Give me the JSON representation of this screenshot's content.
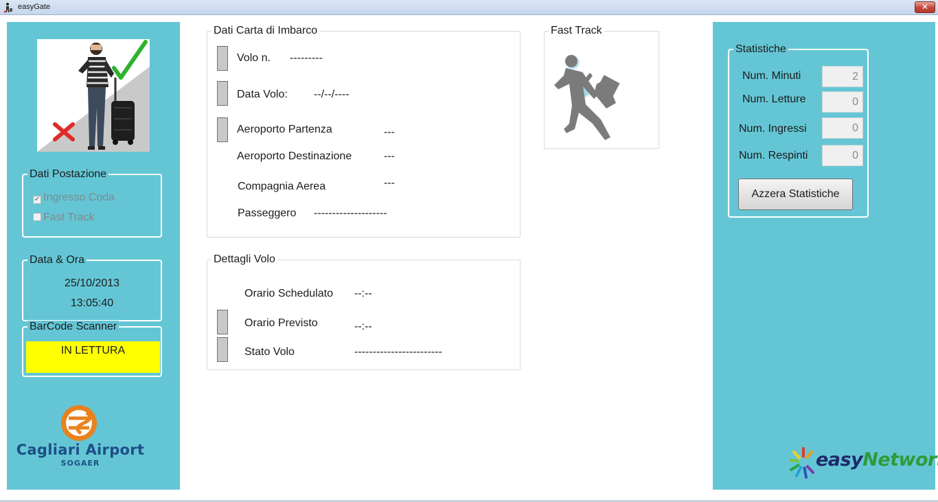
{
  "window": {
    "title": "easyGate",
    "close_glyph": "✕"
  },
  "left": {
    "postazione": {
      "legend": "Dati Postazione",
      "ingresso_coda": "Ingresso Coda",
      "ingresso_coda_checked": true,
      "fast_track": "Fast Track",
      "fast_track_checked": false
    },
    "datetime": {
      "legend": "Data & Ora",
      "date": "25/10/2013",
      "time": "13:05:40"
    },
    "scanner": {
      "legend": "BarCode Scanner",
      "status": "IN LETTURA"
    },
    "logo": {
      "name": "Cagliari Airport",
      "sub": "SOGAER"
    }
  },
  "boarding": {
    "legend": "Dati Carta di Imbarco",
    "volo_label": "Volo n.",
    "volo_value": "---------",
    "data_label": "Data Volo:",
    "data_value": "--/--/----",
    "partenza_label": "Aeroporto Partenza",
    "partenza_value": "---",
    "destinazione_label": "Aeroporto Destinazione",
    "destinazione_value": "---",
    "compagnia_label": "Compagnia Aerea",
    "compagnia_value": "---",
    "passeggero_label": "Passeggero",
    "passeggero_value": "--------------------"
  },
  "details": {
    "legend": "Dettagli Volo",
    "schedulato_label": "Orario Schedulato",
    "schedulato_value": "--:--",
    "previsto_label": "Orario Previsto",
    "previsto_value": "--:--",
    "stato_label": "Stato Volo",
    "stato_value": "------------------------"
  },
  "fasttrack": {
    "legend": "Fast Track"
  },
  "stats": {
    "legend": "Statistiche",
    "minuti_label": "Num. Minuti",
    "minuti_value": "2",
    "letture_label": "Num. Letture",
    "letture_value": "0",
    "ingressi_label": "Num. Ingressi",
    "ingressi_value": "0",
    "respinti_label": "Num. Respinti",
    "respinti_value": "0",
    "reset_button": "Azzera Statistiche"
  },
  "brand": {
    "easy": "easy",
    "network": "Network"
  },
  "colors": {
    "panel": "#64c6d5",
    "scanner_status": "#ffff00",
    "brand_blue": "#1d4e86",
    "brand_orange": "#e8821e"
  }
}
